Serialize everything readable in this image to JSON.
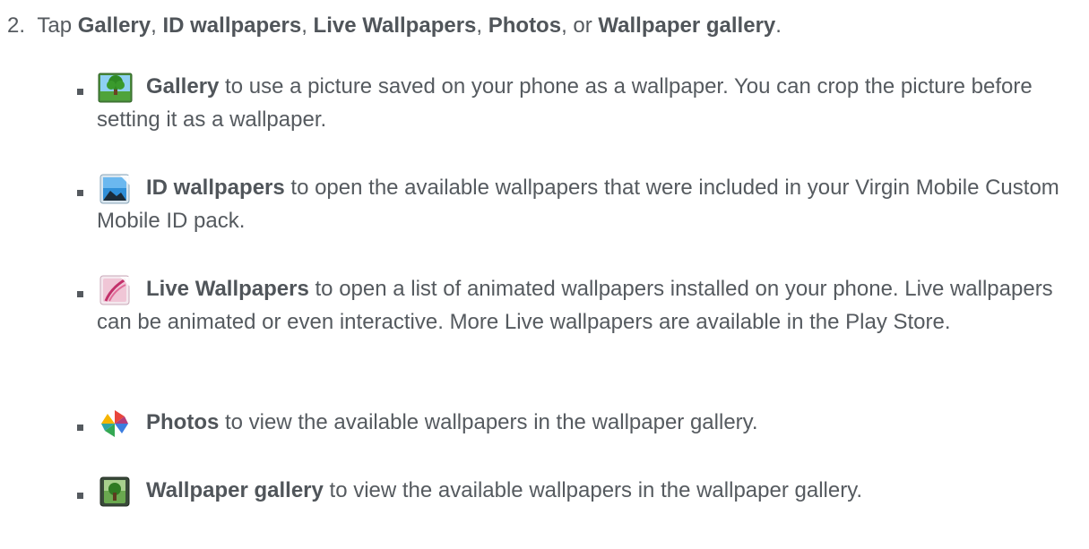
{
  "step": {
    "number": "2.",
    "prefix": "Tap ",
    "opt1": "Gallery",
    "sep1": ", ",
    "opt2": "ID wallpapers",
    "sep2": ", ",
    "opt3": "Live Wallpapers",
    "sep3": ", ",
    "opt4": "Photos",
    "sep4": ", or ",
    "opt5": "Wallpaper gallery",
    "suffix": "."
  },
  "items": [
    {
      "icon": "gallery-tree-icon",
      "bold": "Gallery",
      "rest": " to use a picture saved on your phone as a wallpaper. You can crop the picture before setting it as a wallpaper."
    },
    {
      "icon": "id-wallpapers-icon",
      "bold": "ID wallpapers",
      "rest": " to open the available wallpapers that were included in your Virgin Mobile Custom Mobile ID pack."
    },
    {
      "icon": "live-wallpapers-icon",
      "bold": "Live Wallpapers",
      "rest": " to open a list of animated wallpapers installed on your phone. Live wallpapers can be animated or even interactive. More Live wallpapers are available in the Play Store."
    },
    {
      "icon": "photos-pinwheel-icon",
      "bold": "Photos",
      "rest": " to view the available wallpapers in the wallpaper gallery."
    },
    {
      "icon": "wallpaper-gallery-icon",
      "bold": "Wallpaper gallery",
      "rest": " to view the available wallpapers in the wallpaper gallery."
    }
  ]
}
